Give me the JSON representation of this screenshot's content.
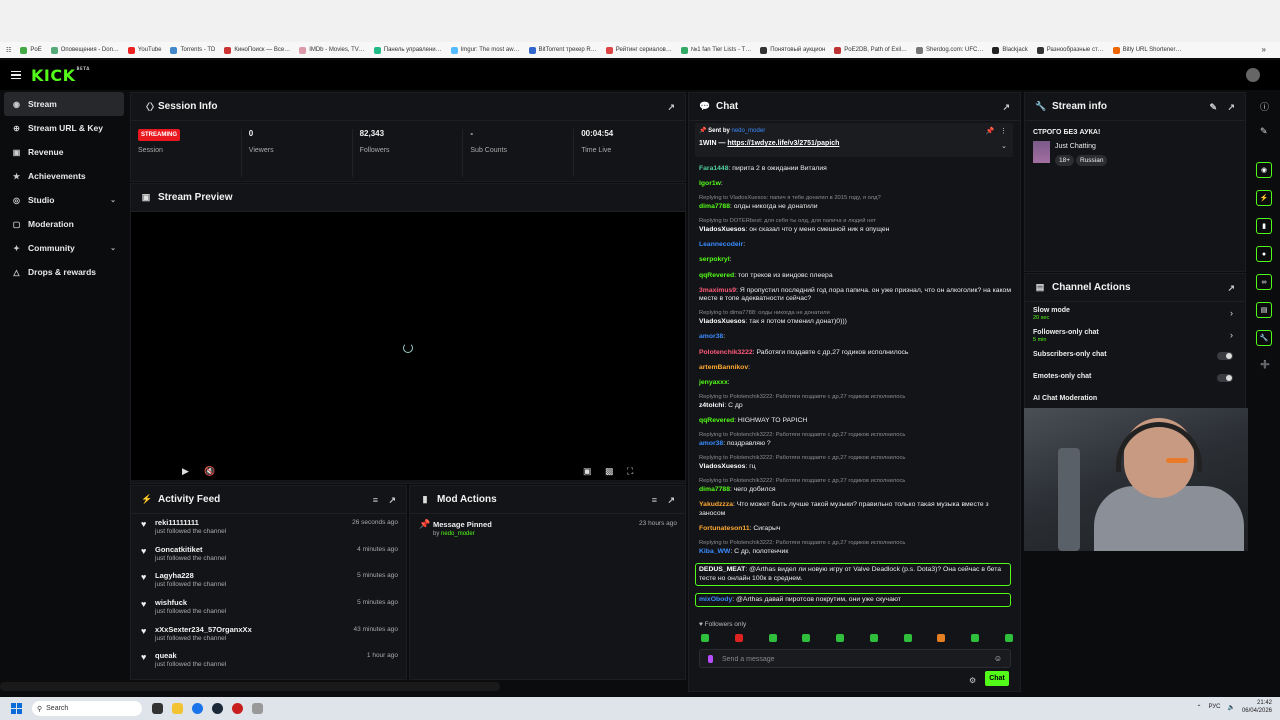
{
  "bookmarks": [
    "PoE",
    "Оповещения - Don…",
    "YouTube",
    "Torrents - TD",
    "КиноПоиск — Все…",
    "IMDb - Movies, TV…",
    "Панель управлени…",
    "Imgur: The most aw…",
    "BitTorrent трекер R…",
    "Рейтинг сериалов…",
    "№1 fan Tier Lists - T…",
    "Понятовый аукцион",
    "PoE2DB, Path of Exil…",
    "Sherdog.com: UFC…",
    "Blackjack",
    "Разнообразные ст…",
    "Bitly URL Shortener…"
  ],
  "header": {
    "logo": "KICK",
    "logo_beta": "BETA"
  },
  "sidebar": {
    "items": [
      {
        "label": "Stream"
      },
      {
        "label": "Stream URL & Key"
      },
      {
        "label": "Revenue"
      },
      {
        "label": "Achievements"
      },
      {
        "label": "Studio"
      },
      {
        "label": "Moderation"
      },
      {
        "label": "Community"
      },
      {
        "label": "Drops & rewards"
      }
    ]
  },
  "session": {
    "title": "Session Info",
    "badge": "STREAMING",
    "stats": [
      {
        "value": "",
        "label": "Session"
      },
      {
        "value": "0",
        "label": "Viewers"
      },
      {
        "value": "82,343",
        "label": "Followers"
      },
      {
        "value": "-",
        "label": "Sub Counts"
      },
      {
        "value": "00:04:54",
        "label": "Time Live"
      }
    ]
  },
  "preview": {
    "title": "Stream Preview"
  },
  "activity": {
    "title": "Activity Feed",
    "items": [
      {
        "name": "reki11111111",
        "sub": "just followed the channel",
        "time": "26 seconds ago"
      },
      {
        "name": "Goncatkitiket",
        "sub": "just followed the channel",
        "time": "4 minutes ago"
      },
      {
        "name": "Lagyha228",
        "sub": "just followed the channel",
        "time": "5 minutes ago"
      },
      {
        "name": "wishfuck",
        "sub": "just followed the channel",
        "time": "5 minutes ago"
      },
      {
        "name": "xXxSexter234_57OrganxXx",
        "sub": "just followed the channel",
        "time": "43 minutes ago"
      },
      {
        "name": "queak",
        "sub": "just followed the channel",
        "time": "1 hour ago"
      }
    ]
  },
  "mod": {
    "title": "Mod Actions",
    "action": "Message Pinned",
    "by_prefix": "by",
    "by_user": "nedo_moder",
    "time": "23 hours ago"
  },
  "chat": {
    "title": "Chat",
    "pinned": {
      "sent_by": "Sent by",
      "user": "nedo_moder",
      "text": "1WIN — ",
      "link": "https://1wdyze.life/v3/2751/papich"
    },
    "messages": [
      {
        "reply": "",
        "user": "Fara1448",
        "color": "#53d0a0",
        "text": "пирита 2 в ожидании Виталия"
      },
      {
        "reply": "",
        "user": "Igor1w",
        "color": "#53fc18",
        "text": ""
      },
      {
        "reply": "Replying to VladosXuesos: папич я тебе донатил в 2015 году, я олд?",
        "user": "dima7788",
        "color": "#53fc18",
        "text": "олды никогда не донатили"
      },
      {
        "reply": "Replying to DOTERbest: для себя ты олд, для папича и людей нет",
        "user": "VladosXuesos",
        "color": "#ffffff",
        "text": "он сказал что у меня смешной ник я опущен"
      },
      {
        "reply": "",
        "user": "Leannecodeir",
        "color": "#3a8cff",
        "text": ""
      },
      {
        "reply": "",
        "user": "serpokryl",
        "color": "#53fc18",
        "text": ""
      },
      {
        "reply": "",
        "user": "qqRevered",
        "color": "#53fc18",
        "text": "топ треков из виндовс плеера"
      },
      {
        "reply": "",
        "user": "3maximus9",
        "color": "#ff5a7a",
        "text": "Я пропустил последний год лора папича. он уже признал, что он алкоголик? на каком месте в топе адекватности сейчас?"
      },
      {
        "reply": "Replying to dima7788: олды никогда не донатили",
        "user": "VladosXuesos",
        "color": "#ffffff",
        "text": "так я потом отменил донат)0)))"
      },
      {
        "reply": "",
        "user": "amor38",
        "color": "#3a8cff",
        "text": ""
      },
      {
        "reply": "",
        "user": "Polotenchik3222",
        "color": "#ff5a7a",
        "text": "Работяги поздавте с др,27 годиков исполнилось"
      },
      {
        "reply": "",
        "user": "artemBannikov",
        "color": "#ffaa33",
        "text": ""
      },
      {
        "reply": "",
        "user": "jenyaxxx",
        "color": "#53fc18",
        "text": ""
      },
      {
        "reply": "Replying to Polotenchik3222: Работяги поздавте с др,27 годиков исполнилось",
        "user": "z4tolchi",
        "color": "#ffffff",
        "text": "С др"
      },
      {
        "reply": "",
        "user": "qqRevered",
        "color": "#53fc18",
        "text": "HIGHWAY TO PAPICH"
      },
      {
        "reply": "Replying to Polotenchik3222: Работяги поздавте с др,27 годиков исполнилось",
        "user": "amor38",
        "color": "#3a8cff",
        "text": "поздравляю ?"
      },
      {
        "reply": "Replying to Polotenchik3222: Работяги поздавте с др,27 годиков исполнилось",
        "user": "VladosXuesos",
        "color": "#ffffff",
        "text": "гц"
      },
      {
        "reply": "Replying to Polotenchik3222: Работяги поздавте с др,27 годиков исполнилось",
        "user": "dima7788",
        "color": "#53fc18",
        "text": "чего добился"
      },
      {
        "reply": "",
        "user": "Yakudzzza",
        "color": "#ffaa33",
        "text": "Что может быть лучше такой музыки? правильно только такая музыка вместе з заносом"
      },
      {
        "reply": "",
        "user": "Fortunateson11",
        "color": "#ffaa33",
        "text": "Сигарыч"
      },
      {
        "reply": "Replying to Polotenchik3222: Работяги поздавте с др,27 годиков исполнилось",
        "user": "Kiba_WW",
        "color": "#3a8cff",
        "text": "С др, полотенчик"
      }
    ],
    "highlighted": [
      {
        "user": "DEDUS_MEAT",
        "color": "#ffffff",
        "text": "@Arthas видел ли новую игру от Valve Deadlock (p.s. Dota3)? Она сейчас в бета тесте но онлайн 100к в среднем."
      },
      {
        "user": "mixObody",
        "color": "#3a8cff",
        "text": "@Arthas давай пиротсов покрутим, они уже скучают"
      }
    ],
    "followers_only": "Followers only",
    "send_placeholder": "Send a message",
    "send_button": "Chat"
  },
  "stream_info": {
    "title": "Stream info",
    "stream_title": "СТРОГО БЕЗ АУКА!",
    "category": "Just Chatting",
    "tags": [
      "18+",
      "Russian"
    ]
  },
  "channel_actions": {
    "title": "Channel Actions",
    "rows": [
      {
        "label": "Slow mode",
        "sub": "20 sec",
        "type": "arrow"
      },
      {
        "label": "Followers-only chat",
        "sub": "5 min",
        "type": "arrow"
      },
      {
        "label": "Subscribers-only chat",
        "sub": "",
        "type": "toggle"
      },
      {
        "label": "Emotes-only chat",
        "sub": "",
        "type": "toggle"
      },
      {
        "label": "AI Chat Moderation",
        "sub": "",
        "type": "none"
      }
    ]
  },
  "taskbar": {
    "search": "Search",
    "lang": "РУС",
    "time": "21:42",
    "date": "06/04/2026"
  }
}
